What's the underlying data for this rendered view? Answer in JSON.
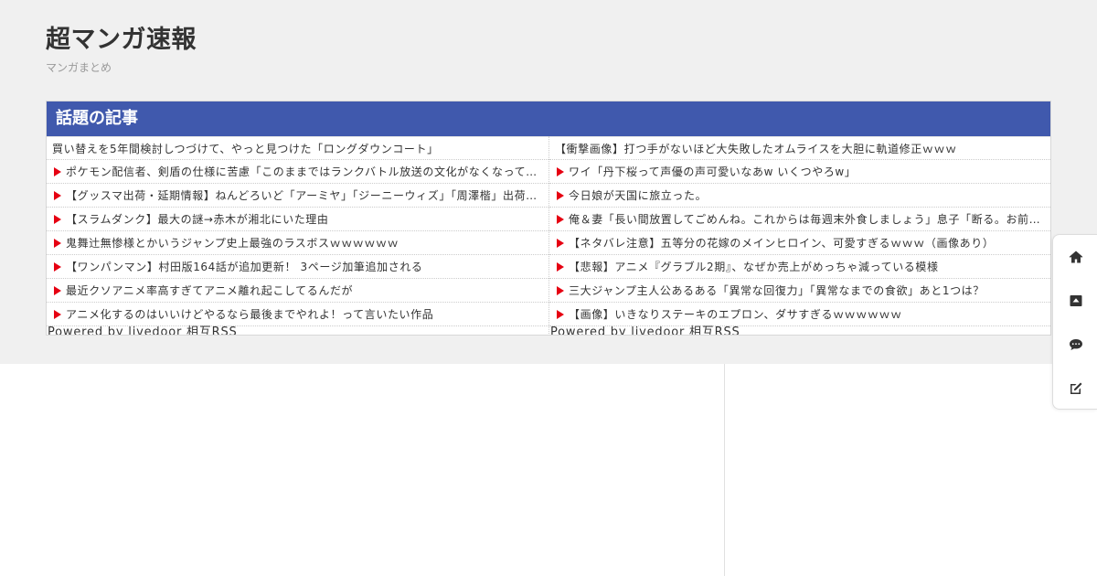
{
  "site": {
    "title": "超マンガ速報",
    "description": "マンガまとめ"
  },
  "widget": {
    "header": "話題の記事",
    "powered_by": "Powered by livedoor 相互RSS",
    "left_column": [
      {
        "text": "買い替えを5年間検討しつづけて、やっと見つけた「ロングダウンコート」",
        "arrow": false
      },
      {
        "text": "ポケモン配信者、剣盾の仕様に苦慮「このままではランクバトル放送の文化がなくなってしまう」",
        "arrow": true
      },
      {
        "text": "【グッスマ出荷・延期情報】ねんどろいど「アーミヤ」「ジーニーウィズ」「周澤楷」出荷開始",
        "arrow": true
      },
      {
        "text": "【スラムダンク】最大の謎→赤木が湘北にいた理由",
        "arrow": true
      },
      {
        "text": "鬼舞辻無惨様とかいうジャンプ史上最強のラスボスｗｗｗｗｗｗ",
        "arrow": true
      },
      {
        "text": "【ワンパンマン】村田版164話が追加更新！ 3ページ加筆追加される",
        "arrow": true
      },
      {
        "text": "最近クソアニメ率高すぎてアニメ離れ起こしてるんだが",
        "arrow": true
      },
      {
        "text": "アニメ化するのはいいけどやるなら最後までやれよ！って言いたい作品",
        "arrow": true
      }
    ],
    "right_column": [
      {
        "text": "【衝撃画像】打つ手がないほど大失敗したオムライスを大胆に軌道修正ｗｗｗ",
        "arrow": false
      },
      {
        "text": "ワイ「丹下桜って声優の声可愛いなあw いくつやろw」",
        "arrow": true
      },
      {
        "text": "今日娘が天国に旅立った。",
        "arrow": true
      },
      {
        "text": "俺＆妻「長い間放置してごめんね。これからは毎週末外食しましょう」息子「断る。お前らとは行かない」",
        "arrow": true
      },
      {
        "text": "【ネタバレ注意】五等分の花嫁のメインヒロイン、可愛すぎるｗｗｗ（画像あり）",
        "arrow": true
      },
      {
        "text": "【悲報】アニメ『グラブル2期』、なぜか売上がめっちゃ減っている模様",
        "arrow": true
      },
      {
        "text": "三大ジャンプ主人公あるある「異常な回復力」「異常なまでの食欲」あと1つは？",
        "arrow": true
      },
      {
        "text": "【画像】いきなりステーキのエプロン、ダサすぎるｗｗｗｗｗｗ",
        "arrow": true
      }
    ]
  },
  "toolbar": {
    "buttons": [
      {
        "icon": "home-icon"
      },
      {
        "icon": "arrow-up-box-icon"
      },
      {
        "icon": "comment-icon"
      },
      {
        "icon": "edit-icon"
      }
    ]
  },
  "colors": {
    "header_bg": "#4059ad",
    "arrow": "#e60012",
    "band_bg": "#f0f0f0"
  }
}
